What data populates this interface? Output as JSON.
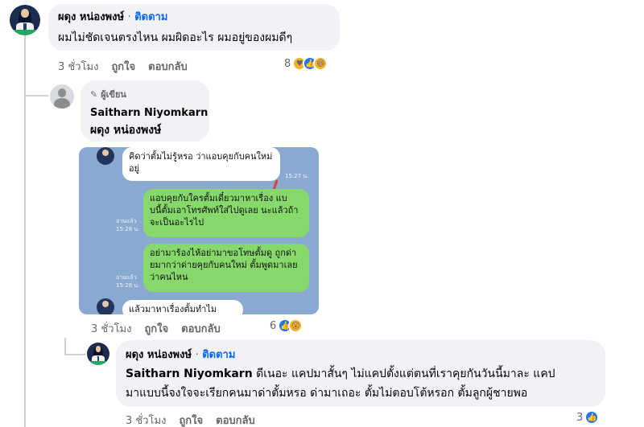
{
  "comment1": {
    "author": "ผดุง หน่องพงษ์",
    "separator": "·",
    "follow_label": "ติดตาม",
    "text": "ผมไม่ชัดเจนตรงไหน ผมผิดอะไร ผมอยู่ของผมดีๆ",
    "time": "3 ชั่วโมง",
    "like_label": "ถูกใจ",
    "reply_label": "ตอบกลับ",
    "reaction_count": "8",
    "reactions": [
      "care",
      "like",
      "haha"
    ]
  },
  "comment2": {
    "badge_label": "ผู้เขียน",
    "author": "Saitharn Niyomkarn",
    "text": "ผดุง หน่องพงษ์",
    "time": "3 ชั่วโมง",
    "like_label": "ถูกใจ",
    "reply_label": "ตอบกลับ",
    "reaction_count": "6",
    "reactions": [
      "like",
      "wow"
    ]
  },
  "chat_screenshot": {
    "msg1": "คิดว่าตั้มไม่รู้หรอ ว่าแอบคุยกับคนใหม่อยู่",
    "msg1_time": "15:27 น.",
    "msg2": "แอบคุยกับใครตั้มเดี๋ยวมาหาเรื่อง แบบนี้ตั้มเอาโทรศัพท์ใส่ไปดูเลย นะแล้วถ้าจะเป็นอะไรไป",
    "msg2_read": "อ่านแล้ว",
    "msg2_time": "15:28 น.",
    "msg3": "อย่ามาร้องไห้อย่ามาขอโทษตั้มดู ถูกด่ายมากว่าด่ายคุยกับคนใหม่ ตั้มพูดมาเลยว่าคนไหน",
    "msg3_read": "อ่านแล้ว",
    "msg3_time": "15:28 น.",
    "msg4": "แล้วมาหาเรื่องตั้มทำไม"
  },
  "comment3": {
    "author": "ผดุง หน่องพงษ์",
    "separator": "·",
    "follow_label": "ติดตาม",
    "mention": "Saitharn Niyomkarn",
    "text": " ดีเนอะ แคปมาสั้นๆ ไม่แคปตั้งแต่ตนที่เราคุยกันวันนี้มาละ แคป",
    "text_line2": "มาแบบนี้จงใจจะเรียกคนมาด่าตั้มหรอ ด่ามาเถอะ ตั้มไม่ตอบโต้หรอก ตั้มลูกผู้ชายพอ",
    "time": "3 ชั่วโมง",
    "like_label": "ถูกใจ",
    "reply_label": "ตอบกลับ",
    "reaction_count": "3",
    "reactions": [
      "like"
    ]
  },
  "colors": {
    "bubble": "#f0f2f5",
    "link": "#0866ff",
    "meta": "#65676b",
    "like": "#1877f2"
  }
}
